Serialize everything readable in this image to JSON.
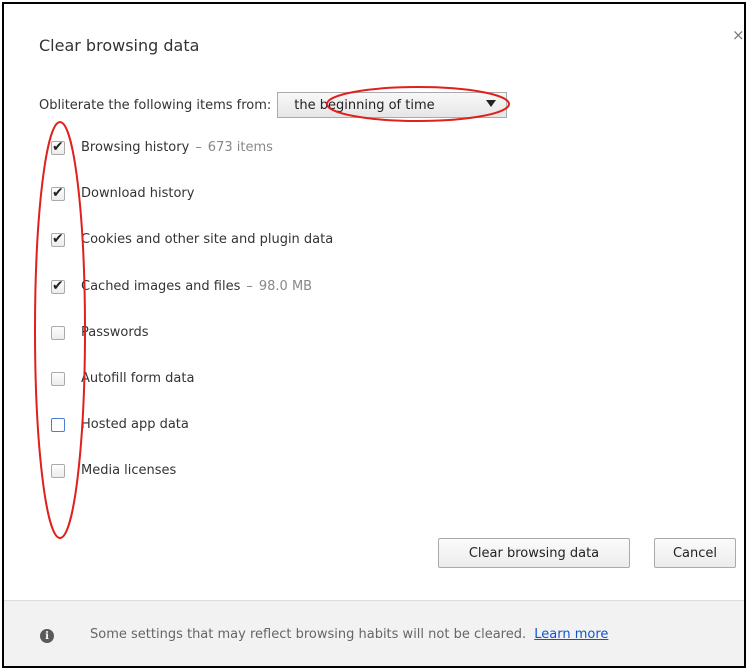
{
  "dialog": {
    "title": "Clear browsing data",
    "close_glyph": "×"
  },
  "time_range": {
    "label": "Obliterate the following items from:",
    "selected": "the beginning of time"
  },
  "items": [
    {
      "label": "Browsing history",
      "detail": "673 items",
      "checked": true
    },
    {
      "label": "Download history",
      "detail": "",
      "checked": true
    },
    {
      "label": "Cookies and other site and plugin data",
      "detail": "",
      "checked": true
    },
    {
      "label": "Cached images and files",
      "detail": "98.0 MB",
      "checked": true
    },
    {
      "label": "Passwords",
      "detail": "",
      "checked": false
    },
    {
      "label": "Autofill form data",
      "detail": "",
      "checked": false
    },
    {
      "label": "Hosted app data",
      "detail": "",
      "checked": false
    },
    {
      "label": "Media licenses",
      "detail": "",
      "checked": false
    }
  ],
  "separator": "–",
  "buttons": {
    "clear": "Clear browsing data",
    "cancel": "Cancel"
  },
  "footer": {
    "text": "Some settings that may reflect browsing habits will not be cleared.",
    "link": "Learn more",
    "info_glyph": "i"
  },
  "colors": {
    "annotation": "#e0201c",
    "link": "#1155cc",
    "focus_checkbox": "#4a7dd8"
  }
}
